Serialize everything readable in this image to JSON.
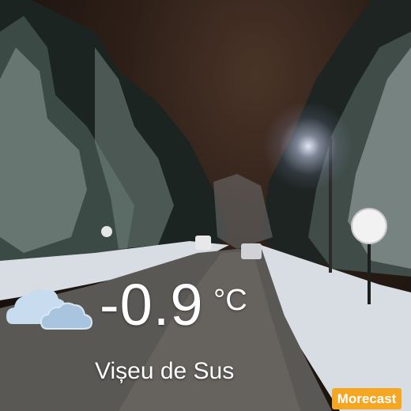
{
  "weather": {
    "icon": "cloudy-icon",
    "temperature": "-0.9",
    "unit": "°C"
  },
  "location": {
    "name": "Vișeu de Sus"
  },
  "brand": {
    "label": "Morecast",
    "color": "#f5a623"
  },
  "colors": {
    "cloud_front": "#c7dcef",
    "cloud_back": "#a9c4de"
  }
}
